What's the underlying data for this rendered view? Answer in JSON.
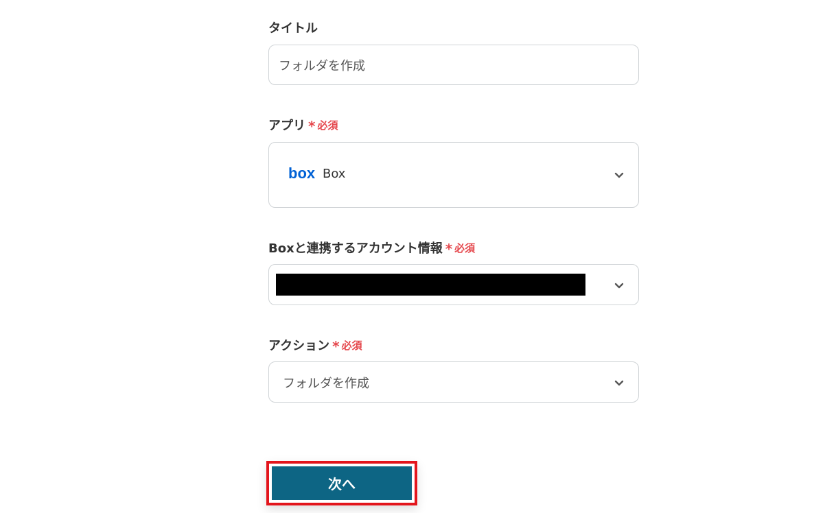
{
  "title_field": {
    "label": "タイトル",
    "value": "フォルダを作成"
  },
  "app_field": {
    "label": "アプリ",
    "required": "必須",
    "value": "Box",
    "logo_text": "box"
  },
  "account_field": {
    "label": "Boxと連携するアカウント情報",
    "required": "必須",
    "value_redacted": true
  },
  "action_field": {
    "label": "アクション",
    "required": "必須",
    "value": "フォルダを作成"
  },
  "next_button": {
    "label": "次へ"
  },
  "colors": {
    "required": "#e5484d",
    "button": "#0d6584",
    "highlight": "#e3151c",
    "box_brand": "#0061d5"
  }
}
